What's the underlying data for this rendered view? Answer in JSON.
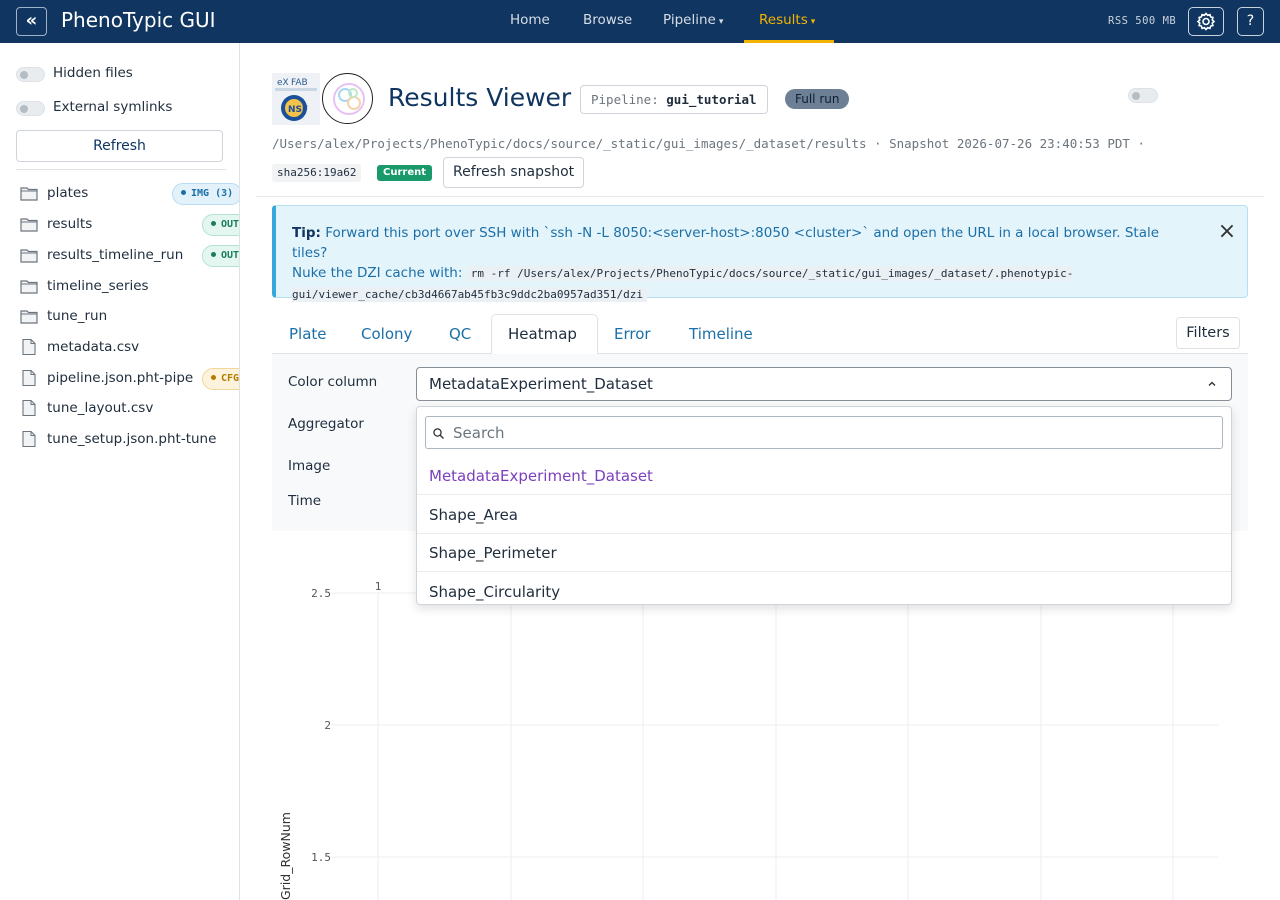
{
  "navbar": {
    "back_label": "«",
    "brand": "PhenoTypic GUI",
    "links": [
      {
        "label": "Home",
        "caret": false
      },
      {
        "label": "Browse",
        "caret": false
      },
      {
        "label": "Pipeline",
        "caret": true
      },
      {
        "label": "Results",
        "caret": true,
        "active": true
      }
    ],
    "rss": "RSS 500 MB",
    "help_label": "?",
    "active_color": "#f5b301",
    "bg_color": "#0f3560"
  },
  "sidebar": {
    "toggles": [
      {
        "label": "Hidden files",
        "on": false
      },
      {
        "label": "External symlinks",
        "on": false
      }
    ],
    "refresh_label": "Refresh",
    "files": [
      {
        "name": "plates",
        "type": "folder",
        "badge": "IMG (3)",
        "badge_kind": "img"
      },
      {
        "name": "results",
        "type": "folder",
        "badge": "OUT",
        "badge_kind": "out"
      },
      {
        "name": "results_timeline_run",
        "type": "folder",
        "badge": "OUT",
        "badge_kind": "out"
      },
      {
        "name": "timeline_series",
        "type": "folder",
        "badge": "",
        "badge_kind": ""
      },
      {
        "name": "tune_run",
        "type": "folder",
        "badge": "",
        "badge_kind": ""
      },
      {
        "name": "metadata.csv",
        "type": "file",
        "badge": "",
        "badge_kind": ""
      },
      {
        "name": "pipeline.json.pht-pipe",
        "type": "file",
        "badge": "CFG",
        "badge_kind": "cfg"
      },
      {
        "name": "tune_layout.csv",
        "type": "file",
        "badge": "",
        "badge_kind": ""
      },
      {
        "name": "tune_setup.json.pht-tune",
        "type": "file",
        "badge": "",
        "badge_kind": ""
      }
    ]
  },
  "header": {
    "title": "Results Viewer",
    "pipeline_label": "Pipeline:",
    "pipeline_value": "gui_tutorial",
    "run_badge": "Full run",
    "path": "/Users/alex/Projects/PhenoTypic/docs/source/_static/gui_images/_dataset/results · Snapshot 2026-07-26 23:40:53 PDT ·",
    "hash": "sha256:19a62",
    "current_badge": "Current",
    "refresh_snapshot": "Refresh snapshot"
  },
  "tip": {
    "label": "Tip:",
    "text1": "Forward this port over SSH with `ssh -N -L 8050:<server-host>:8050 <cluster>` and open the URL in a local browser. Stale tiles?",
    "text2": "Nuke the DZI cache with:",
    "code": "rm -rf /Users/alex/Projects/PhenoTypic/docs/source/_static/gui_images/_dataset/.phenotypic-gui/viewer_cache/cb3d4667ab45fb3c9ddc2ba0957ad351/dzi",
    "close": "×"
  },
  "tabs": {
    "items": [
      "Plate",
      "Colony",
      "QC",
      "Heatmap",
      "Error",
      "Timeline"
    ],
    "active": "Heatmap",
    "filters_label": "Filters"
  },
  "controls": {
    "color_column_label": "Color column",
    "color_column_value": "MetadataExperiment_Dataset",
    "aggregator_label": "Aggregator",
    "image_label": "Image",
    "time_label": "Time"
  },
  "dropdown": {
    "search_placeholder": "Search",
    "options": [
      "MetadataExperiment_Dataset",
      "Shape_Area",
      "Shape_Perimeter",
      "Shape_Circularity"
    ],
    "selected": "MetadataExperiment_Dataset",
    "selected_color": "#7b3fbf"
  },
  "chart_data": {
    "type": "heatmap",
    "ylabel": "Grid_RowNum",
    "yticks": [
      "2.5",
      "2",
      "1.5"
    ],
    "ytick_values": [
      2.5,
      2,
      1.5
    ],
    "top_labels": [
      "1"
    ],
    "grid": true
  }
}
